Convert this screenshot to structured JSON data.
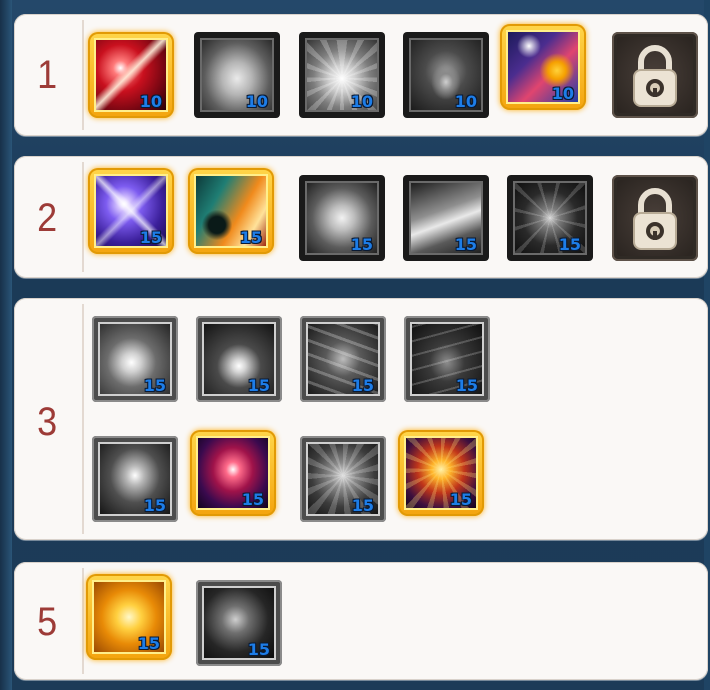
{
  "tiers": [
    {
      "label": "1",
      "skills": [
        {
          "name": "crimson-slash-skill-icon",
          "level": "10",
          "selected": true
        },
        {
          "name": "muscular-torso-skill-icon",
          "level": "10",
          "selected": false
        },
        {
          "name": "armored-chest-skill-icon",
          "level": "10",
          "selected": false
        },
        {
          "name": "aura-warrior-skill-icon",
          "level": "10",
          "selected": false
        },
        {
          "name": "mage-caster-skill-icon",
          "level": "10",
          "selected": true
        }
      ],
      "locked": true
    },
    {
      "label": "2",
      "skills": [
        {
          "name": "violet-starburst-skill-icon",
          "level": "15",
          "selected": true
        },
        {
          "name": "flame-swordsman-skill-icon",
          "level": "15",
          "selected": true
        },
        {
          "name": "power-flex-skill-icon",
          "level": "15",
          "selected": false
        },
        {
          "name": "wind-slash-skill-icon",
          "level": "15",
          "selected": false
        },
        {
          "name": "shadow-strike-skill-icon",
          "level": "15",
          "selected": false
        }
      ],
      "locked": true
    },
    {
      "label": "3",
      "rows": [
        [
          {
            "name": "radiant-blast-skill-icon",
            "level": "15",
            "selected": false
          },
          {
            "name": "white-flare-skill-icon",
            "level": "15",
            "selected": false
          },
          {
            "name": "swirl-cut-skill-icon",
            "level": "15",
            "selected": false
          },
          {
            "name": "dark-swirl-skill-icon",
            "level": "15",
            "selected": false
          }
        ],
        [
          {
            "name": "sword-pillar-skill-icon",
            "level": "15",
            "selected": false
          },
          {
            "name": "crimson-pillar-skill-icon",
            "level": "15",
            "selected": true
          },
          {
            "name": "stone-bloom-skill-icon",
            "level": "15",
            "selected": false
          },
          {
            "name": "ember-bloom-skill-icon",
            "level": "15",
            "selected": true
          }
        ]
      ]
    },
    {
      "label": "5",
      "skills": [
        {
          "name": "golden-hero-skill-icon",
          "level": "15",
          "selected": true
        },
        {
          "name": "shadow-hero-skill-icon",
          "level": "15",
          "selected": false
        }
      ]
    }
  ],
  "colors": {
    "tier_number": "#9d3b37",
    "level_text": "#1d7de8",
    "selected_frame": "#f4a40e",
    "panel_bg": "#faf8f6",
    "window_bg": "#1d3a55"
  }
}
